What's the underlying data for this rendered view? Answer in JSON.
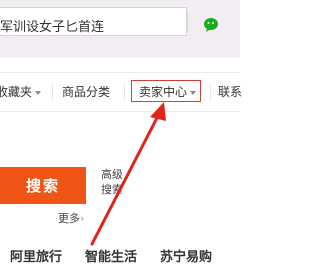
{
  "search": {
    "text": "军训设女子匕首连"
  },
  "nav": {
    "items": [
      {
        "label": "收藏夹",
        "caret": true
      },
      {
        "label": "商品分类",
        "caret": false
      },
      {
        "label": "卖家中心",
        "caret": true
      },
      {
        "label": "联系",
        "caret": false
      }
    ]
  },
  "search_panel": {
    "search_button": "搜索",
    "advanced_search": "高级搜索",
    "more": "更多"
  },
  "bottom_links": [
    {
      "label": "阿里旅行"
    },
    {
      "label": "智能生活"
    },
    {
      "label": "苏宁易购"
    }
  ],
  "colors": {
    "top_band": "#f2edf2",
    "search_button": "#f05516",
    "highlight_border": "#c9423b",
    "arrow": "#e2231a",
    "wechat": "#1aad19"
  },
  "icons": [
    "wechat-icon",
    "chevron-right-icon",
    "caret-down-icon"
  ]
}
